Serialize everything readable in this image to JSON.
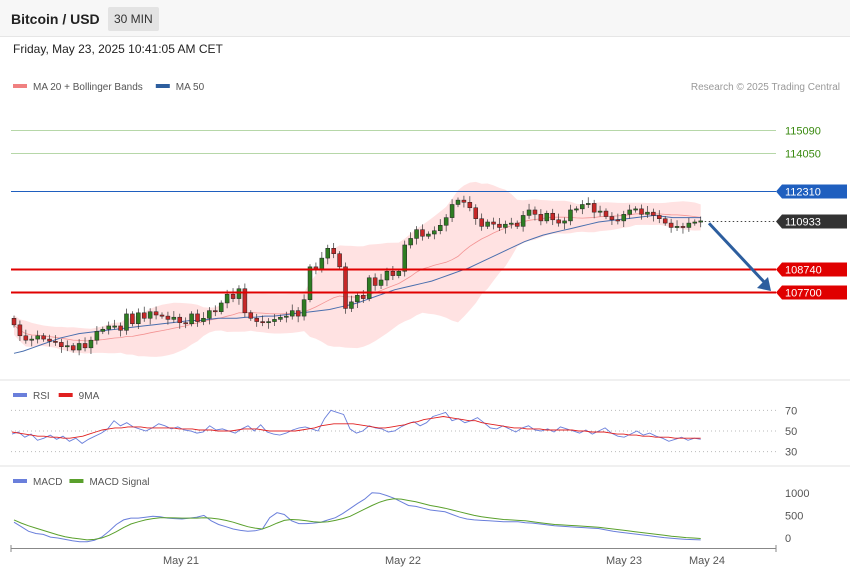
{
  "header": {
    "title": "Bitcoin / USD",
    "timeframe": "30 MIN"
  },
  "date": "Friday, May 23, 2025 10:41:05 AM CET",
  "colors": {
    "up": "#2e7d22",
    "down": "#c62828",
    "ma20": "#f08080",
    "bands": "#ffd6d6",
    "ma50": "#4a6fae",
    "resistance_green": "#6aa84f",
    "resistance_blue": "#1f5fbf",
    "support_red": "#e00000",
    "current": "#333333",
    "rsi": "#6a7fdb",
    "rsi_ma": "#e02020",
    "macd": "#6a7fdb",
    "macd_signal": "#5aa02c",
    "arrow": "#2d5e9e"
  },
  "chart_data": [
    {
      "type": "candlestick",
      "title": "Bitcoin / USD",
      "legend": [
        {
          "name": "MA 20 + Bollinger Bands",
          "color": "#f08080"
        },
        {
          "name": "MA 50",
          "color": "#2d5e9e"
        }
      ],
      "credit": "Research © 2025 Trading Central",
      "x_ticks": [
        "May 21",
        "May 22",
        "May 23",
        "May 24"
      ],
      "y_range": [
        104000,
        116200
      ],
      "levels": [
        {
          "label": "115090",
          "value": 115090,
          "kind": "resistance"
        },
        {
          "label": "114050",
          "value": 114050,
          "kind": "resistance"
        },
        {
          "label": "112310",
          "value": 112310,
          "kind": "pivot"
        },
        {
          "label": "110933",
          "value": 110933,
          "kind": "current"
        },
        {
          "label": "108740",
          "value": 108740,
          "kind": "support"
        },
        {
          "label": "107700",
          "value": 107700,
          "kind": "support"
        }
      ],
      "forecast": {
        "direction": "down",
        "target": 107700
      },
      "close_series": [
        106200,
        105700,
        105500,
        105550,
        105700,
        105550,
        105450,
        105400,
        105200,
        105250,
        105050,
        105350,
        105150,
        105500,
        105900,
        106000,
        106150,
        106150,
        105950,
        106700,
        106250,
        106750,
        106500,
        106800,
        106650,
        106600,
        106450,
        106550,
        106300,
        106250,
        106700,
        106350,
        106500,
        106850,
        106800,
        107200,
        107600,
        107400,
        107850,
        106750,
        106500,
        106350,
        106300,
        106350,
        106450,
        106550,
        106600,
        106850,
        106600,
        107350,
        108850,
        108750,
        109250,
        109700,
        109450,
        108850,
        106950,
        107250,
        107550,
        107400,
        108350,
        108000,
        108250,
        108650,
        108450,
        108650,
        109850,
        110150,
        110550,
        110250,
        110350,
        110500,
        110750,
        111100,
        111700,
        111900,
        111800,
        111550,
        111050,
        110700,
        110900,
        110800,
        110650,
        110800,
        110850,
        110700,
        111200,
        111450,
        111250,
        110950,
        111300,
        111000,
        110850,
        110950,
        111450,
        111500,
        111700,
        111750,
        111350,
        111400,
        111150,
        111000,
        110950,
        111250,
        111450,
        111500,
        111250,
        111350,
        111200,
        111050,
        110850,
        110650,
        110700,
        110650,
        110850,
        110900,
        110950
      ],
      "ma50_series": [
        104900,
        105000,
        105150,
        105300,
        105450,
        105600,
        105700,
        105800,
        105850,
        105900,
        105950,
        106000,
        106050,
        106100,
        106150,
        106200,
        106250,
        106300,
        106350,
        106400,
        106400,
        106450,
        106500,
        106500,
        106500,
        106550,
        106550,
        106600,
        106600,
        106650,
        106700,
        106750,
        106800,
        106850,
        106900,
        107000,
        107100,
        107200,
        107350,
        107500,
        107650,
        107800,
        107900,
        108000,
        108100,
        108200,
        108350,
        108500,
        108650,
        108800,
        109000,
        109200,
        109400,
        109600,
        109800,
        110000,
        110150,
        110300,
        110400,
        110500,
        110600,
        110700,
        110800,
        110900,
        110950,
        111000,
        111050,
        111100,
        111150,
        111200,
        111150,
        111100,
        111100,
        111100,
        111100
      ]
    },
    {
      "type": "line",
      "title": "RSI",
      "series": [
        {
          "name": "RSI",
          "color": "#6a7fdb"
        },
        {
          "name": "9MA",
          "color": "#e02020"
        }
      ],
      "y_ticks": [
        "70",
        "50",
        "30"
      ],
      "y_range": [
        20,
        80
      ],
      "rsi_values": [
        47,
        49,
        44,
        47,
        41,
        43,
        46,
        42,
        45,
        40,
        43,
        38,
        42,
        45,
        48,
        52,
        60,
        55,
        58,
        54,
        52,
        50,
        53,
        57,
        55,
        52,
        54,
        51,
        50,
        48,
        49,
        55,
        51,
        52,
        50,
        48,
        52,
        55,
        50,
        56,
        49,
        47,
        46,
        48,
        51,
        53,
        54,
        52,
        50,
        62,
        70,
        68,
        66,
        52,
        48,
        50,
        55,
        53,
        52,
        49,
        50,
        54,
        57,
        59,
        55,
        58,
        64,
        66,
        68,
        60,
        62,
        58,
        60,
        63,
        58,
        53,
        52,
        55,
        52,
        49,
        53,
        55,
        51,
        50,
        52,
        49,
        54,
        52,
        50,
        48,
        51,
        47,
        50,
        53,
        48,
        45,
        44,
        47,
        50,
        46,
        48,
        45,
        43,
        40,
        42,
        44,
        41,
        43,
        42
      ],
      "ma_values": [
        49,
        48,
        47,
        46,
        45,
        45,
        44,
        44,
        43,
        43,
        44,
        45,
        47,
        49,
        51,
        52,
        53,
        53,
        54,
        54,
        54,
        53,
        53,
        53,
        53,
        53,
        52,
        52,
        52,
        51,
        51,
        51,
        50,
        50,
        50,
        51,
        52,
        52,
        52,
        51,
        50,
        50,
        50,
        50,
        50,
        51,
        52,
        53,
        55,
        56,
        57,
        57,
        57,
        57,
        56,
        55,
        54,
        53,
        53,
        54,
        55,
        56,
        58,
        59,
        61,
        62,
        63,
        64,
        63,
        62,
        61,
        60,
        60,
        58,
        57,
        56,
        55,
        54,
        53,
        53,
        52,
        52,
        52,
        51,
        51,
        51,
        51,
        51,
        50,
        50,
        49,
        49,
        49,
        48,
        47,
        47,
        46,
        46,
        45,
        45,
        44,
        44,
        44,
        43,
        43,
        43,
        43,
        43
      ]
    },
    {
      "type": "line",
      "title": "MACD",
      "series": [
        {
          "name": "MACD",
          "color": "#6a7fdb"
        },
        {
          "name": "MACD Signal",
          "color": "#5aa02c"
        }
      ],
      "y_ticks": [
        "1000",
        "500",
        "0"
      ],
      "y_range": [
        -220,
        1150
      ],
      "macd_values": [
        350,
        250,
        150,
        100,
        80,
        20,
        0,
        -30,
        -60,
        -80,
        -80,
        -50,
        20,
        150,
        300,
        400,
        440,
        440,
        460,
        480,
        470,
        440,
        430,
        420,
        440,
        460,
        500,
        380,
        300,
        250,
        200,
        170,
        150,
        160,
        200,
        450,
        560,
        520,
        380,
        320,
        320,
        330,
        350,
        400,
        450,
        540,
        650,
        760,
        860,
        1000,
        990,
        940,
        880,
        800,
        720,
        700,
        660,
        620,
        600,
        580,
        520,
        460,
        420,
        400,
        390,
        380,
        370,
        360,
        360,
        360,
        340,
        330,
        310,
        290,
        270,
        260,
        250,
        240,
        230,
        220,
        210,
        180,
        150,
        130,
        110,
        90,
        70,
        50,
        30,
        10,
        -5,
        -20,
        -30,
        -35,
        -40
      ],
      "signal_values": [
        400,
        330,
        270,
        220,
        170,
        120,
        70,
        30,
        0,
        -20,
        -40,
        -30,
        0,
        60,
        140,
        230,
        310,
        360,
        400,
        430,
        450,
        450,
        445,
        440,
        440,
        440,
        450,
        440,
        420,
        390,
        350,
        300,
        250,
        220,
        200,
        260,
        330,
        390,
        410,
        400,
        380,
        360,
        350,
        360,
        390,
        430,
        480,
        560,
        640,
        720,
        790,
        840,
        870,
        860,
        830,
        800,
        760,
        720,
        690,
        660,
        620,
        580,
        540,
        500,
        470,
        450,
        430,
        410,
        400,
        390,
        380,
        360,
        340,
        320,
        300,
        290,
        280,
        270,
        260,
        250,
        240,
        220,
        200,
        180,
        160,
        140,
        120,
        100,
        80,
        60,
        40,
        25,
        10,
        0,
        -10
      ]
    }
  ]
}
